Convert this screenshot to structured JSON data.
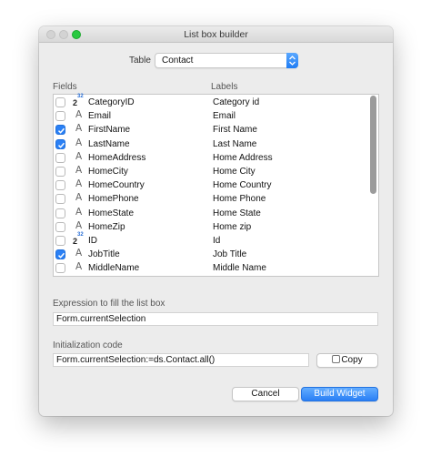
{
  "window": {
    "title": "List box builder"
  },
  "table": {
    "label": "Table",
    "value": "Contact"
  },
  "columns": {
    "fields": "Fields",
    "labels": "Labels"
  },
  "rows": [
    {
      "checked": false,
      "type": "number",
      "field": "CategoryID",
      "label": "Category id"
    },
    {
      "checked": false,
      "type": "text",
      "field": "Email",
      "label": "Email"
    },
    {
      "checked": true,
      "type": "text",
      "field": "FirstName",
      "label": "First Name"
    },
    {
      "checked": true,
      "type": "text",
      "field": "LastName",
      "label": "Last Name"
    },
    {
      "checked": false,
      "type": "text",
      "field": "HomeAddress",
      "label": "Home Address"
    },
    {
      "checked": false,
      "type": "text",
      "field": "HomeCity",
      "label": "Home City"
    },
    {
      "checked": false,
      "type": "text",
      "field": "HomeCountry",
      "label": "Home Country"
    },
    {
      "checked": false,
      "type": "text",
      "field": "HomePhone",
      "label": "Home Phone"
    },
    {
      "checked": false,
      "type": "text",
      "field": "HomeState",
      "label": "Home State"
    },
    {
      "checked": false,
      "type": "text",
      "field": "HomeZip",
      "label": "Home zip"
    },
    {
      "checked": false,
      "type": "number",
      "field": "ID",
      "label": "Id"
    },
    {
      "checked": true,
      "type": "text",
      "field": "JobTitle",
      "label": "Job Title"
    },
    {
      "checked": false,
      "type": "text",
      "field": "MiddleName",
      "label": "Middle Name"
    }
  ],
  "type_icons": {
    "text": "A",
    "number_base": "2",
    "number_sup": "32"
  },
  "expression": {
    "label": "Expression to fill the list box",
    "value": "Form.currentSelection"
  },
  "init": {
    "label": "Initialization code",
    "value": "Form.currentSelection:=ds.Contact.all()",
    "copy_label": "Copy"
  },
  "buttons": {
    "cancel": "Cancel",
    "build": "Build Widget"
  },
  "colors": {
    "accent": "#2a80f5",
    "maximize": "#28c940"
  }
}
